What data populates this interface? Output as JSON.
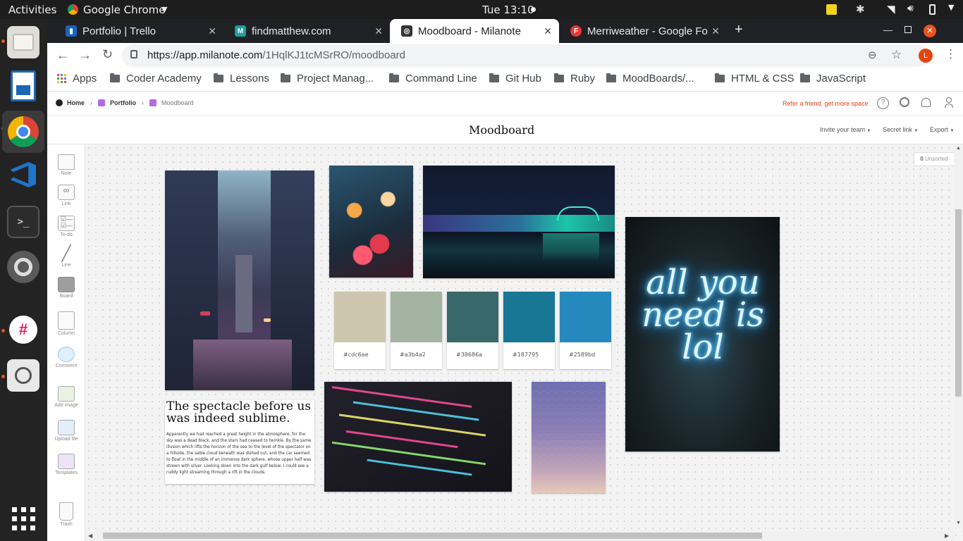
{
  "topbar": {
    "activities": "Activities",
    "app": "Google Chrome",
    "clock": "Tue 13:10"
  },
  "tabs": [
    {
      "title": "Portfolio | Trello",
      "color": "#1565c0",
      "glyph": "▮"
    },
    {
      "title": "findmatthew.com",
      "color": "#19a0a0",
      "glyph": "M"
    },
    {
      "title": "Moodboard - Milanote",
      "color": "#333333",
      "glyph": "◎"
    },
    {
      "title": "Merriweather - Google Fo",
      "color": "#e53935",
      "glyph": "F"
    }
  ],
  "address": {
    "prefix": "https://app.milanote.com",
    "path": "/1HqlKJ1tcMSrRO/moodboard",
    "avatar": "L"
  },
  "bookmarks": [
    "Apps",
    "Coder Academy",
    "Lessons",
    "Project Manag...",
    "Command Line",
    "Git Hub",
    "Ruby",
    "MoodBoards/...",
    "HTML & CSS",
    "JavaScript"
  ],
  "milanote": {
    "breadcrumb": [
      "Home",
      "Portfolio",
      "Moodboard"
    ],
    "refer": "Refer a friend, get more space",
    "title": "Moodboard",
    "menu": [
      "Invite your team",
      "Secret link",
      "Export"
    ],
    "unsorted_count": "0",
    "unsorted_label": "Unsorted"
  },
  "tools": [
    "Note",
    "Link",
    "To-do",
    "Line",
    "Board",
    "Column",
    "Comment",
    "Add image",
    "Upload file",
    "Templates"
  ],
  "trash": "Trash",
  "swatches": [
    {
      "label": "#cdc6ae",
      "color": "#cdc6ae"
    },
    {
      "label": "#a3b4a2",
      "color": "#a3b4a2"
    },
    {
      "label": "#38686a",
      "color": "#38686a"
    },
    {
      "label": "#187795",
      "color": "#187795"
    },
    {
      "label": "#2589bd",
      "color": "#2589bd"
    }
  ],
  "note": {
    "heading": "The spectacle before us was indeed sublime.",
    "body": "Apparently we had reached a great height in the atmosphere, for the sky was a dead black, and the stars had ceased to twinkle. By the same illusion which lifts the horizon of the sea to the level of the spectator on a hillside, the sable cloud beneath was dished out, and the car seemed to float in the middle of an immense dark sphere, whose upper half was strewn with silver. Looking down into the dark gulf below, I could see a ruddy light streaming through a rift in the clouds."
  },
  "neon_text": "all you need is lol"
}
